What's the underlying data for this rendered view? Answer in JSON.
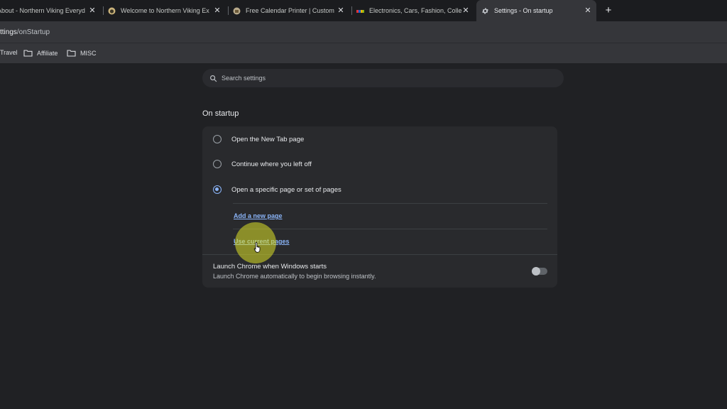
{
  "tabs": [
    {
      "title": "About - Northern Viking Everyd",
      "active": false
    },
    {
      "title": "Welcome to Northern Viking Ex",
      "active": false
    },
    {
      "title": "Free Calendar Printer | Custom",
      "active": false
    },
    {
      "title": "Electronics, Cars, Fashion, Colle",
      "active": false
    },
    {
      "title": "Settings - On startup",
      "active": true
    }
  ],
  "address": {
    "prefix": "ttings",
    "path": "/onStartup"
  },
  "bookmarks": [
    "Travel",
    "Affiliate",
    "MISC"
  ],
  "search": {
    "placeholder": "Search settings"
  },
  "section_title": "On startup",
  "startup_options": [
    {
      "label": "Open the New Tab page",
      "checked": false
    },
    {
      "label": "Continue where you left off",
      "checked": false
    },
    {
      "label": "Open a specific page or set of pages",
      "checked": true
    }
  ],
  "links": {
    "add_page": "Add a new page",
    "use_current": "Use current pages"
  },
  "launch": {
    "title": "Launch Chrome when Windows starts",
    "subtitle": "Launch Chrome automatically to begin browsing instantly.",
    "enabled": false
  },
  "colors": {
    "accent": "#8ab4f8",
    "background": "#202124",
    "card": "#292a2d",
    "cursor_highlight": "#dce026"
  }
}
